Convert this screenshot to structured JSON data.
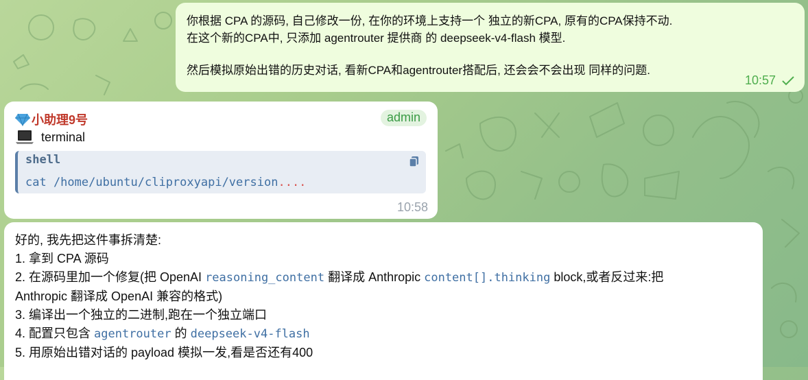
{
  "outgoing": {
    "line1": "你根据 CPA 的源码, 自己修改一份, 在你的环境上支持一个 独立的新CPA, 原有的CPA保持不动.",
    "line2": "在这个新的CPA中, 只添加 agentrouter 提供商 的 deepseek-v4-flash 模型.",
    "line3": "然后模拟原始出错的历史对话, 看新CPA和agentrouter搭配后, 还会会不会出现 同样的问题.",
    "time": "10:57",
    "status_icon": "double-check-icon",
    "accent": "#4fae4e"
  },
  "terminal_msg": {
    "sender_icon": "gem-icon",
    "sender": "小助理9号",
    "badge": "admin",
    "tool_icon": "laptop-icon",
    "tool_label": "terminal",
    "code_lang": "shell",
    "code_text": "cat /home/ubuntu/cliproxyapi/version",
    "code_dots": "....",
    "time": "10:58"
  },
  "reply_msg": {
    "intro": "好的, 我先把这件事拆清楚:",
    "item1": "1. 拿到 CPA 源码",
    "item2_a": "2. 在源码里加一个修复(把 OpenAI ",
    "item2_code1": "reasoning_content",
    "item2_b": " 翻译成 Anthropic ",
    "item2_code2": "content[].thinking",
    "item2_c": " block,或者反过来:把",
    "item2_cont": "Anthropic 翻译成 OpenAI 兼容的格式)",
    "item3": "3. 编译出一个独立的二进制,跑在一个独立端口",
    "item4_a": "4. 配置只包含 ",
    "item4_code1": "agentrouter",
    "item4_b": " 的 ",
    "item4_code2": "deepseek-v4-flash",
    "item5": "5. 用原始出错对话的 payload 模拟一发,看是否还有400"
  }
}
